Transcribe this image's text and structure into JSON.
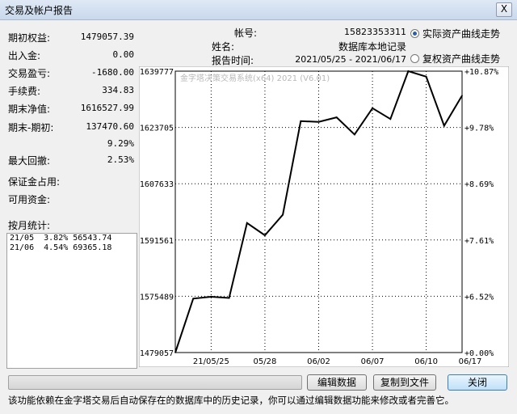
{
  "window": {
    "title": "交易及帐户报告",
    "close_label": "X"
  },
  "summary": {
    "initial_equity_label": "期初权益:",
    "initial_equity": "1479057.39",
    "deposit_label": "出入金:",
    "deposit": "0.00",
    "trade_pnl_label": "交易盈亏:",
    "trade_pnl": "-1680.00",
    "fee_label": "手续费:",
    "fee": "334.83",
    "final_equity_label": "期末净值:",
    "final_equity": "1616527.99",
    "diff_label": "期末-期初:",
    "diff": "137470.60",
    "diff_pct": "9.29%",
    "max_drawdown_label": "最大回撤:",
    "max_drawdown": "2.53%",
    "margin_label": "保证金占用:",
    "available_label": "可用资金:",
    "monthly_label": "按月统计:"
  },
  "monthly_stats": [
    "21/05  3.82% 56543.74",
    "21/06  4.54% 69365.18"
  ],
  "info": {
    "account_label": "帐号:",
    "account": "15823353311",
    "name_label": "姓名:",
    "name": "数据库本地记录",
    "report_time_label": "报告时间:",
    "report_time": "2021/05/25 - 2021/06/17"
  },
  "radios": {
    "actual": "实际资产曲线走势",
    "compound": "复权资产曲线走势"
  },
  "buttons": {
    "edit": "编辑数据",
    "copy": "复制到文件",
    "close": "关闭"
  },
  "footer": "该功能依赖在金字塔交易后自动保存在的数据库中的历史记录，你可以通过编辑数据功能来修改或者完善它。",
  "chart_data": {
    "type": "line",
    "watermark": "金字塔决策交易系统(x64) 2021 (V6.01)",
    "y_left_ticks": [
      "1639777",
      "1623705",
      "1607633",
      "1591561",
      "1575489",
      "1479057"
    ],
    "y_right_ticks": [
      "+10.87%",
      "+9.78%",
      "+8.69%",
      "+7.61%",
      "+6.52%",
      "+0.00%"
    ],
    "x_ticks": [
      "21/05/25",
      "05/28",
      "06/02",
      "06/07",
      "06/10",
      "06/17"
    ],
    "values": [
      1479057,
      1571500,
      1574700,
      1572600,
      1596400,
      1592900,
      1598800,
      1625500,
      1625300,
      1626600,
      1621700,
      1629200,
      1626100,
      1646200,
      1638200,
      1624200,
      1632800
    ],
    "ylim": [
      1479057,
      1639777
    ],
    "grid": true,
    "color": "#000000"
  }
}
